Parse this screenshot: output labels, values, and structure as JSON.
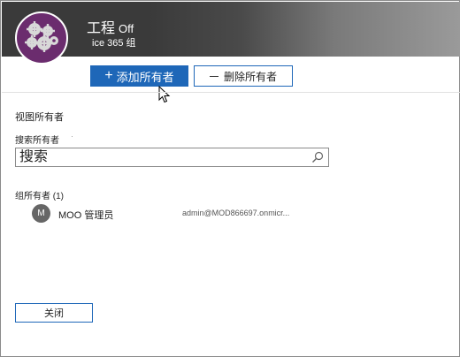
{
  "header": {
    "title": "工程",
    "title_suffix": "Off",
    "subtitle": "ice 365 组"
  },
  "toolbar": {
    "add_label": "添加所有者",
    "remove_label": "删除所有者"
  },
  "owners_panel": {
    "view_heading": "视图所有者",
    "search_label": "搜索所有者",
    "search_placeholder": "搜索",
    "group_owners_label": "组所有者",
    "group_owners_count": "(1)",
    "owners": [
      {
        "initial": "M",
        "name": "MOO 管理员",
        "email": "admin@MOD866697.onmicr..."
      }
    ]
  },
  "footer": {
    "close_label": "关闭"
  },
  "colors": {
    "header_bg": "#3a3a3a",
    "avatar_bg": "#6b2c6e",
    "accent": "#1e67b8"
  },
  "icons": {
    "group_avatar": "gears-icon",
    "add": "plus-icon",
    "remove": "minus-icon",
    "search": "search-icon",
    "cursor": "mouse-pointer-icon"
  }
}
